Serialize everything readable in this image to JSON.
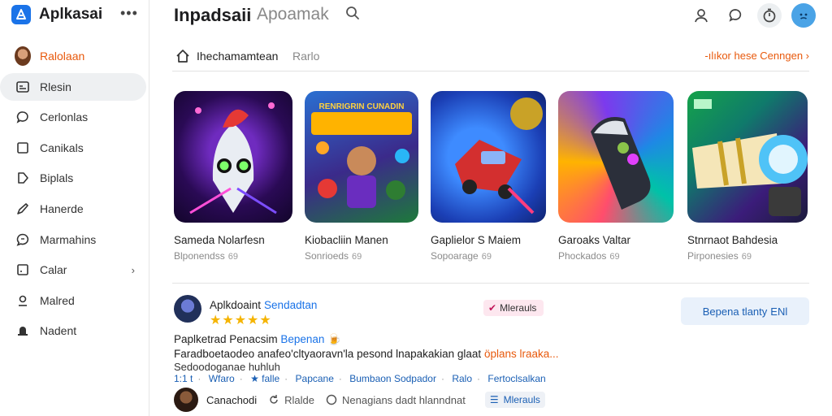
{
  "brand": {
    "name": "Aplkasai",
    "more_icon": "more-horizontal-icon"
  },
  "sidebar": {
    "items": [
      {
        "label": "Ralolaan",
        "icon": "avatar",
        "accent": true
      },
      {
        "label": "Rlesin",
        "icon": "window-icon",
        "active": true
      },
      {
        "label": "Cerlonlas",
        "icon": "chat-bubble-icon"
      },
      {
        "label": "Canikals",
        "icon": "square-icon"
      },
      {
        "label": "Biplals",
        "icon": "tag-icon"
      },
      {
        "label": "Hanerde",
        "icon": "pen-icon"
      },
      {
        "label": "Marmahins",
        "icon": "message-icon"
      },
      {
        "label": "Calar",
        "icon": "calendar-icon",
        "chevron": "›"
      },
      {
        "label": "Malred",
        "icon": "pin-icon"
      },
      {
        "label": "Nadent",
        "icon": "bell-icon"
      }
    ]
  },
  "header": {
    "title": "Inpadsaii",
    "search_text": "Apoamak",
    "colors": {
      "accent": "#1a73e8",
      "orange": "#e8590c"
    }
  },
  "section": {
    "title": "Ihechamamtean",
    "subtitle": "Rarlo",
    "link": "-ılıkor hese Cenngen ›"
  },
  "cards": [
    {
      "name": "Sameda Nolarfesn",
      "meta": "Blponendss",
      "badge": "69"
    },
    {
      "name": "Kiobacliin Manen",
      "meta": "Sonrioeds",
      "badge": "69"
    },
    {
      "name": "Gaplielor S Maiem",
      "meta": "Sopoarage",
      "badge": "69"
    },
    {
      "name": "Garoaks Valtar",
      "meta": "Phockados",
      "badge": "69"
    },
    {
      "name": "Stnrnaot Bahdesia",
      "meta": "Pirponesies",
      "badge": "69"
    }
  ],
  "card_art": {
    "card2_banner": "RENRIGRIN CUNADIN"
  },
  "review": {
    "name": "Aplkdoaint",
    "name_link": "Sendadtan",
    "stars": "★★★★★",
    "tag": "Mlerauls",
    "cta": "Bepena tlanty",
    "cta_suffix": "ENl",
    "title": "Paplketrad Penacsim",
    "title_link": "Bepenan",
    "body_line1": "Faradboetaodeo anafeo'cltyaoravn'la pesond lnapakakian glaat",
    "body_line1_accent": "öplans lraaka...",
    "body_line2": "Sedoodoganae huhluh",
    "tags": [
      "1:1 t",
      "Wfaro",
      "★ falle",
      "Papcane",
      "Bumbaon Sodpador",
      "Ralo",
      "Fertoclsalkan"
    ],
    "footer": {
      "author": "Canachodi",
      "action1": "Rlalde",
      "action2": "Nenagians dadt hlanndnat",
      "tag": "Mlerauls"
    }
  }
}
